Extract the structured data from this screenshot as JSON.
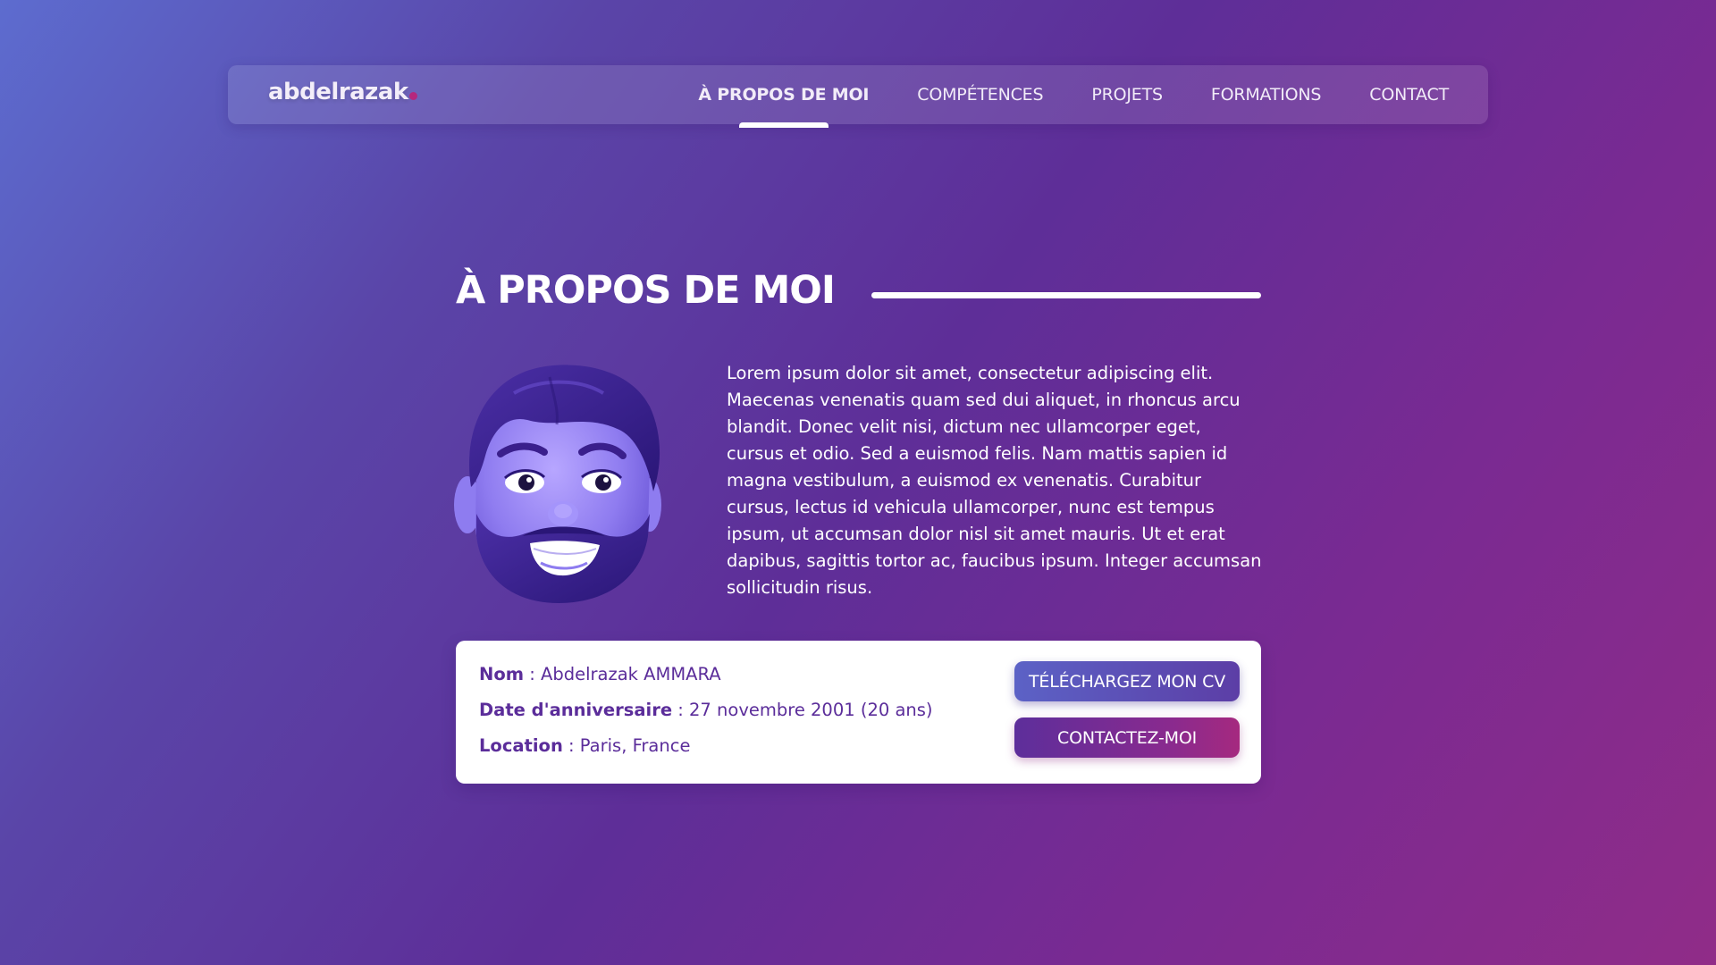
{
  "nav": {
    "logo": "abdelrazak",
    "items": [
      {
        "label": "À PROPOS DE MOI",
        "active": true
      },
      {
        "label": "COMPÉTENCES",
        "active": false
      },
      {
        "label": "PROJETS",
        "active": false
      },
      {
        "label": "FORMATIONS",
        "active": false
      },
      {
        "label": "CONTACT",
        "active": false
      }
    ]
  },
  "about": {
    "title": "À PROPOS DE MOI",
    "avatar_icon": "memoji-avatar",
    "bio": "Lorem ipsum dolor sit amet, consectetur adipiscing elit. Maecenas venenatis quam sed dui aliquet, in rhoncus arcu blandit. Donec velit nisi, dictum nec ullamcorper eget, cursus et odio. Sed a euismod felis. Nam mattis sapien id magna vestibulum, a euismod ex venenatis. Curabitur cursus, lectus id vehicula ullamcorper, nunc est tempus ipsum, ut accumsan dolor nisl sit amet mauris. Ut et erat dapibus, sagittis tortor ac, faucibus ipsum. Integer accumsan sollicitudin risus."
  },
  "info": {
    "name_label": "Nom",
    "name_value": " : Abdelrazak AMMARA",
    "birthday_label": "Date d'anniversaire",
    "birthday_value": " : 27 novembre 2001 (20 ans)",
    "location_label": "Location",
    "location_value": " : Paris, France"
  },
  "actions": {
    "download_cv": "TÉLÉCHARGEZ MON CV",
    "contact_me": "CONTACTEZ-MOI"
  },
  "colors": {
    "accent": "#5b2d9a",
    "logo_dot": "#b6277d",
    "gradient_start": "#5d6ccf",
    "gradient_end": "#902c88"
  }
}
